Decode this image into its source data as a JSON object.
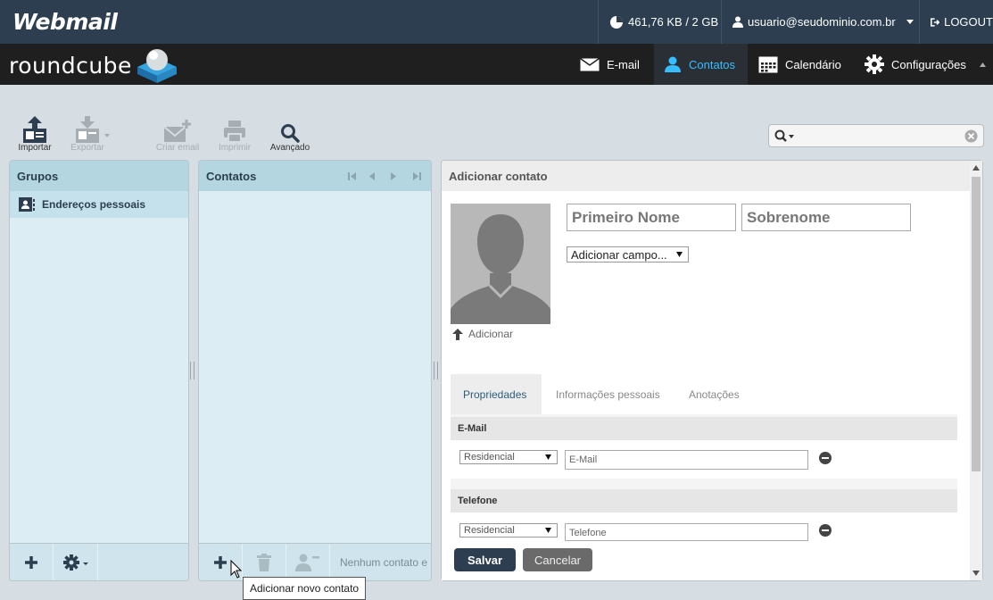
{
  "header": {
    "brand": "Webmail",
    "quota": "461,76 KB / 2 GB",
    "user": "usuario@seudominio.com.br",
    "logout": "LOGOUT"
  },
  "nav": {
    "logo": "roundcube",
    "items": [
      {
        "label": "E-mail",
        "icon": "envelope-icon"
      },
      {
        "label": "Contatos",
        "icon": "person-icon",
        "active": true
      },
      {
        "label": "Calendário",
        "icon": "calendar-icon"
      },
      {
        "label": "Configurações",
        "icon": "gear-icon"
      }
    ]
  },
  "toolbar": {
    "import": "Importar",
    "export": "Exportar",
    "compose": "Criar email",
    "print": "Imprimir",
    "advanced": "Avançado"
  },
  "groups": {
    "title": "Grupos",
    "items": [
      "Endereços pessoais"
    ]
  },
  "contacts": {
    "title": "Contatos",
    "count_text": "Nenhum contato e"
  },
  "form": {
    "title": "Adicionar contato",
    "first_name_placeholder": "Primeiro Nome",
    "last_name_placeholder": "Sobrenome",
    "add_field": "Adicionar campo...",
    "add_photo": "Adicionar",
    "tabs": [
      "Propriedades",
      "Informações pessoais",
      "Anotações"
    ],
    "email_section": "E-Mail",
    "email_type": "Residencial",
    "email_placeholder": "E-Mail",
    "phone_section": "Telefone",
    "phone_type": "Residencial",
    "phone_placeholder": "Telefone",
    "save": "Salvar",
    "cancel": "Cancelar"
  },
  "tooltip": "Adicionar novo contato",
  "colors": {
    "topbar": "#2c3e50",
    "navbar": "#1f1f1f",
    "accent": "#37beff",
    "panel": "#dcedf4"
  }
}
